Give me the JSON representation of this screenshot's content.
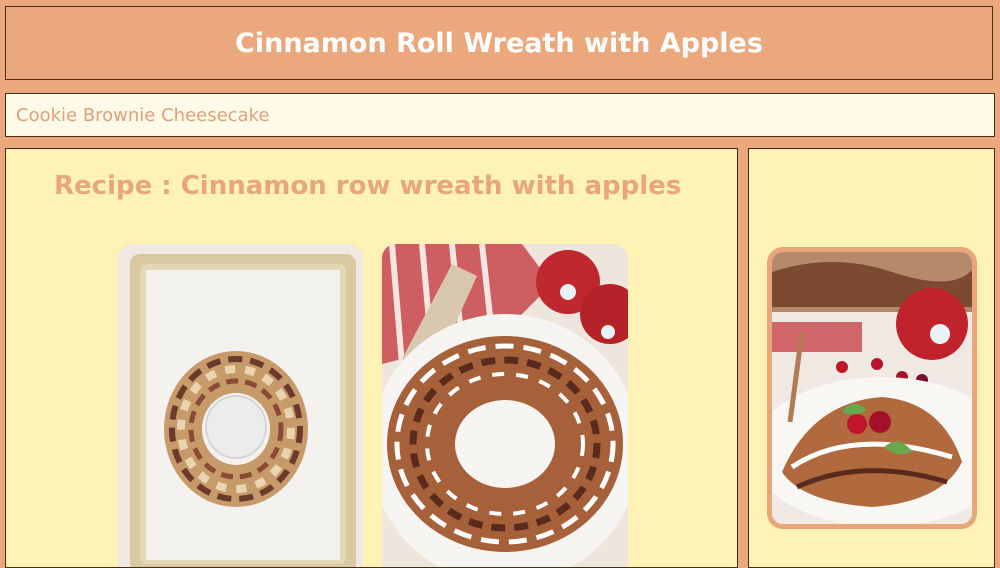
{
  "header": {
    "title": "Cinnamon Roll Wreath with Apples"
  },
  "search": {
    "value": "Cookie Brownie Cheesecake"
  },
  "main": {
    "recipe_title": "Recipe : Cinnamon row wreath with apples"
  },
  "colors": {
    "background": "#eba87c",
    "panel": "#fff2b5",
    "accent_text": "#e9a67a",
    "border": "#4a2a1a"
  }
}
